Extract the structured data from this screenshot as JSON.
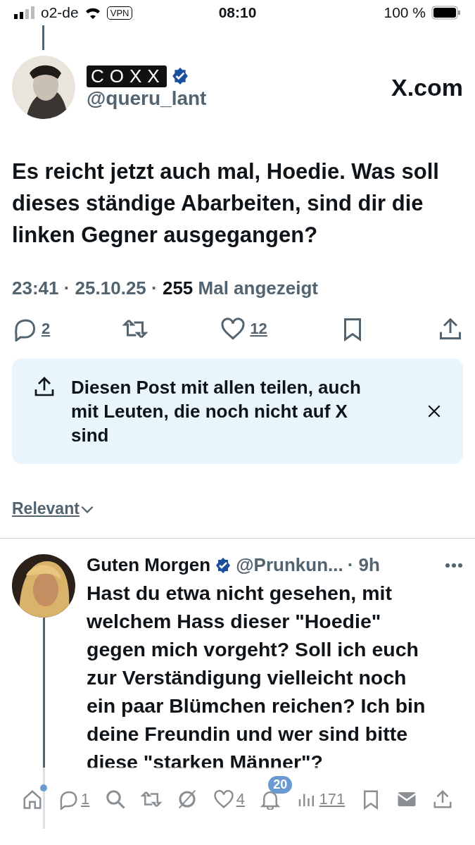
{
  "status_bar": {
    "carrier": "o2-de",
    "vpn": "VPN",
    "time": "08:10",
    "battery": "100 %"
  },
  "post": {
    "display_name": "COXX",
    "handle": "@queru_lant",
    "site": "X.com",
    "text": "Es reicht jetzt auch mal, Hoedie. Was soll dieses ständige Abarbeiten, sind dir die linken Gegner ausgegangen?",
    "time": "23:41 · 25.10.25 · ",
    "views": "255",
    "views_label": " Mal angezeigt",
    "actions": [
      {
        "kind": "reply",
        "count": "2"
      },
      {
        "kind": "repost"
      },
      {
        "kind": "like",
        "count": "12"
      },
      {
        "kind": "bookmark"
      },
      {
        "kind": "share"
      }
    ]
  },
  "share_tip": {
    "text": "Diesen Post mit allen teilen, auch mit Leuten, die noch nicht auf X sind"
  },
  "sort": {
    "label": "Relevant"
  },
  "reply": {
    "name": "Guten Morgen",
    "handle": "@Prunkun...",
    "age": "· 9h",
    "text": "Hast du etwa nicht gesehen, mit welchem Hass dieser \"Hoedie\" gegen mich vorgeht? Soll ich euch zur Verständigung vielleicht noch ein paar Blümchen reichen? Ich bin deine Freundin und wer sind bitte diese \"starken Männer\"?"
  },
  "bottom_bar": [
    {
      "kind": "home"
    },
    {
      "kind": "reply",
      "count": "1"
    },
    {
      "kind": "search"
    },
    {
      "kind": "repost"
    },
    {
      "kind": "grok"
    },
    {
      "kind": "like",
      "count": "4"
    },
    {
      "kind": "bell",
      "badge": "20"
    },
    {
      "kind": "views",
      "count": "171"
    },
    {
      "kind": "bookmark"
    },
    {
      "kind": "mail"
    },
    {
      "kind": "share"
    }
  ]
}
